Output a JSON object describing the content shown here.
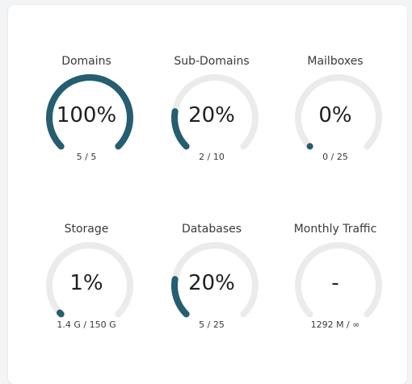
{
  "colors": {
    "accent": "#245e70",
    "track": "#ebebeb"
  },
  "gauges": [
    {
      "title": "Domains",
      "value_text": "100%",
      "usage": "5 / 5",
      "fraction": 1.0
    },
    {
      "title": "Sub-Domains",
      "value_text": "20%",
      "usage": "2 / 10",
      "fraction": 0.2
    },
    {
      "title": "Mailboxes",
      "value_text": "0%",
      "usage": "0 / 25",
      "fraction": 0.0
    },
    {
      "title": "Storage",
      "value_text": "1%",
      "usage": "1.4 G / 150 G",
      "fraction": 0.01
    },
    {
      "title": "Databases",
      "value_text": "20%",
      "usage": "5 / 25",
      "fraction": 0.2
    },
    {
      "title": "Monthly Traffic",
      "value_text": "-",
      "usage": "1292 M / ∞",
      "fraction": null
    }
  ]
}
